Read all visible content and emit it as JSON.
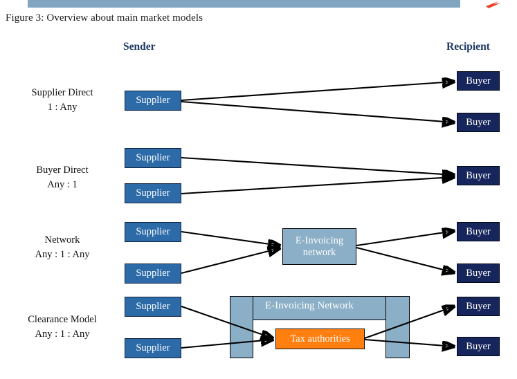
{
  "figure": {
    "caption": "Figure 3: Overview about main market models",
    "banner_color": "#82a6c2",
    "accent_mark_color": "#e8442a"
  },
  "columns": {
    "sender_label": "Sender",
    "recipient_label": "Recipient",
    "header_color": "#1f3864"
  },
  "palette": {
    "supplier": "#2c6ba8",
    "buyer": "#16255c",
    "network": "#8bafc7",
    "tax": "#ff7f11",
    "connector": "#000000"
  },
  "rows": [
    {
      "id": "supplier-direct",
      "title": "Supplier Direct",
      "ratio": "1 : Any",
      "senders": [
        "Supplier"
      ],
      "recipients": [
        "Buyer",
        "Buyer"
      ],
      "intermediary": null
    },
    {
      "id": "buyer-direct",
      "title": "Buyer Direct",
      "ratio": "Any : 1",
      "senders": [
        "Supplier",
        "Supplier"
      ],
      "recipients": [
        "Buyer"
      ],
      "intermediary": null
    },
    {
      "id": "network",
      "title": "Network",
      "ratio": "Any : 1 : Any",
      "senders": [
        "Supplier",
        "Supplier"
      ],
      "recipients": [
        "Buyer",
        "Buyer"
      ],
      "intermediary": {
        "line1": "E-Invoicing",
        "line2": "network"
      }
    },
    {
      "id": "clearance-model",
      "title": "Clearance Model",
      "ratio": "Any : 1 : Any",
      "senders": [
        "Supplier",
        "Supplier"
      ],
      "recipients": [
        "Buyer",
        "Buyer"
      ],
      "intermediary": {
        "container": "E-Invoicing Network",
        "inner": "Tax authorities"
      }
    }
  ]
}
